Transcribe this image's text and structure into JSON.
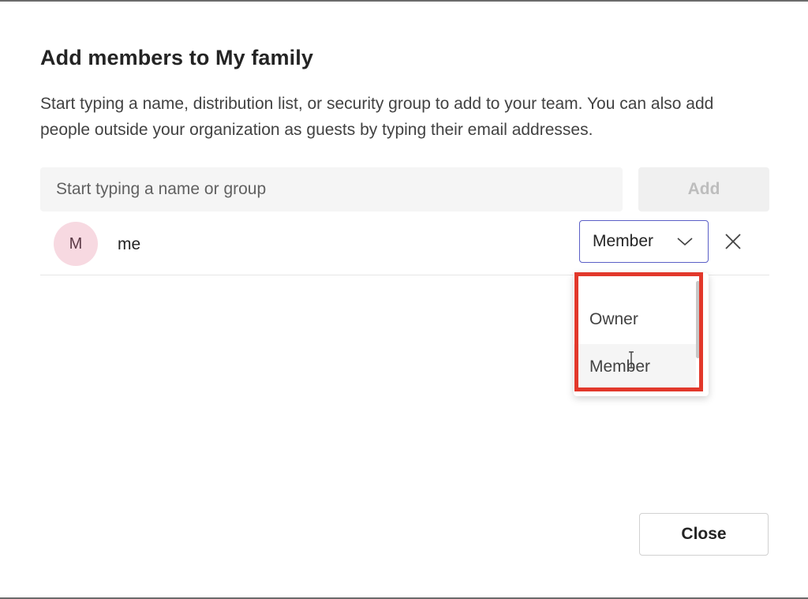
{
  "dialog": {
    "title": "Add members to My family",
    "description": "Start typing a name, distribution list, or security group to add to your team. You can also add people outside your organization as guests by typing their email addresses."
  },
  "search": {
    "placeholder": "Start typing a name or group",
    "value": ""
  },
  "add_button": {
    "label": "Add"
  },
  "member": {
    "initial": "M",
    "name": "me",
    "role": "Member",
    "avatar_color": "#f7d9e1"
  },
  "role_options": [
    {
      "label": "Owner"
    },
    {
      "label": "Member"
    }
  ],
  "close_button": {
    "label": "Close"
  },
  "colors": {
    "accent": "#5b5fc7",
    "highlight": "#e2382b"
  },
  "icons": {
    "dropdown": "chevron-down-icon",
    "remove": "close-icon",
    "cursor": "text-cursor-icon"
  }
}
